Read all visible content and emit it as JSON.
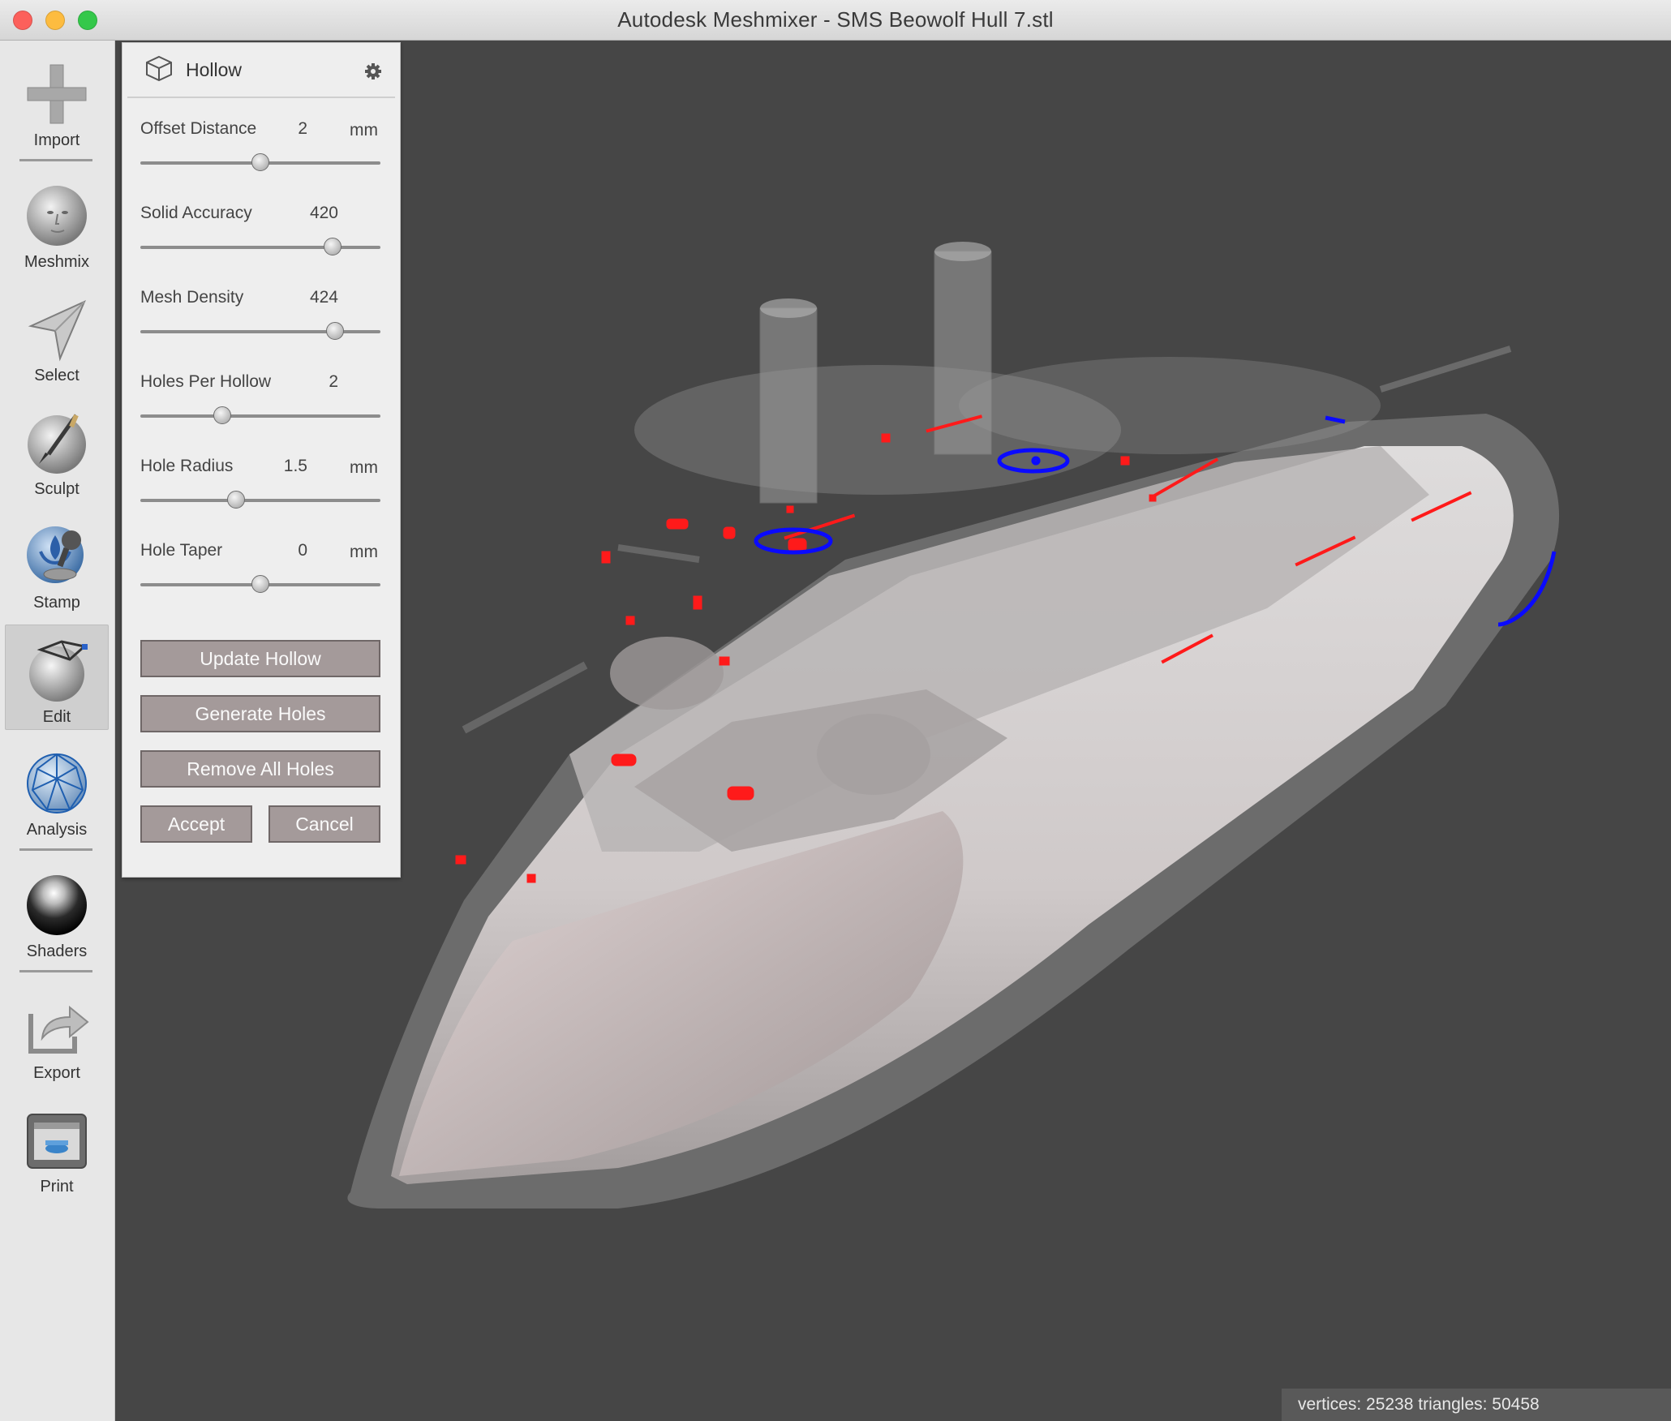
{
  "window": {
    "title": "Autodesk Meshmixer - SMS Beowolf Hull 7.stl"
  },
  "toolbar": {
    "items": [
      {
        "label": "Import",
        "icon": "plus-icon"
      },
      {
        "label": "Meshmix",
        "icon": "face-sphere-icon"
      },
      {
        "label": "Select",
        "icon": "arrow-cursor-icon"
      },
      {
        "label": "Sculpt",
        "icon": "brush-icon"
      },
      {
        "label": "Stamp",
        "icon": "stamp-icon"
      },
      {
        "label": "Edit",
        "icon": "edit-sphere-icon",
        "active": true
      },
      {
        "label": "Analysis",
        "icon": "mesh-sphere-icon"
      },
      {
        "label": "Shaders",
        "icon": "shader-sphere-icon"
      },
      {
        "label": "Export",
        "icon": "export-icon"
      },
      {
        "label": "Print",
        "icon": "printer-icon"
      }
    ]
  },
  "panel": {
    "title": "Hollow",
    "params": [
      {
        "name": "Offset Distance",
        "value": "2",
        "unit": "mm",
        "level": 0.5
      },
      {
        "name": "Solid Accuracy",
        "value": "420",
        "unit": "",
        "level": 0.8
      },
      {
        "name": "Mesh Density",
        "value": "424",
        "unit": "",
        "level": 0.81
      },
      {
        "name": "Holes Per Hollow",
        "value": "2",
        "unit": "",
        "level": 0.34
      },
      {
        "name": "Hole Radius",
        "value": "1.5",
        "unit": "mm",
        "level": 0.4
      },
      {
        "name": "Hole Taper",
        "value": "0",
        "unit": "mm",
        "level": 0.5
      }
    ],
    "buttons": {
      "update": "Update Hollow",
      "generate": "Generate Holes",
      "remove": "Remove All Holes",
      "accept": "Accept",
      "cancel": "Cancel"
    }
  },
  "status": {
    "text": "vertices: 25238 triangles: 50458"
  },
  "colors": {
    "viewport_bg": "#464646",
    "hole_marker": "#ff0000",
    "hole_ring": "#0000ff"
  }
}
